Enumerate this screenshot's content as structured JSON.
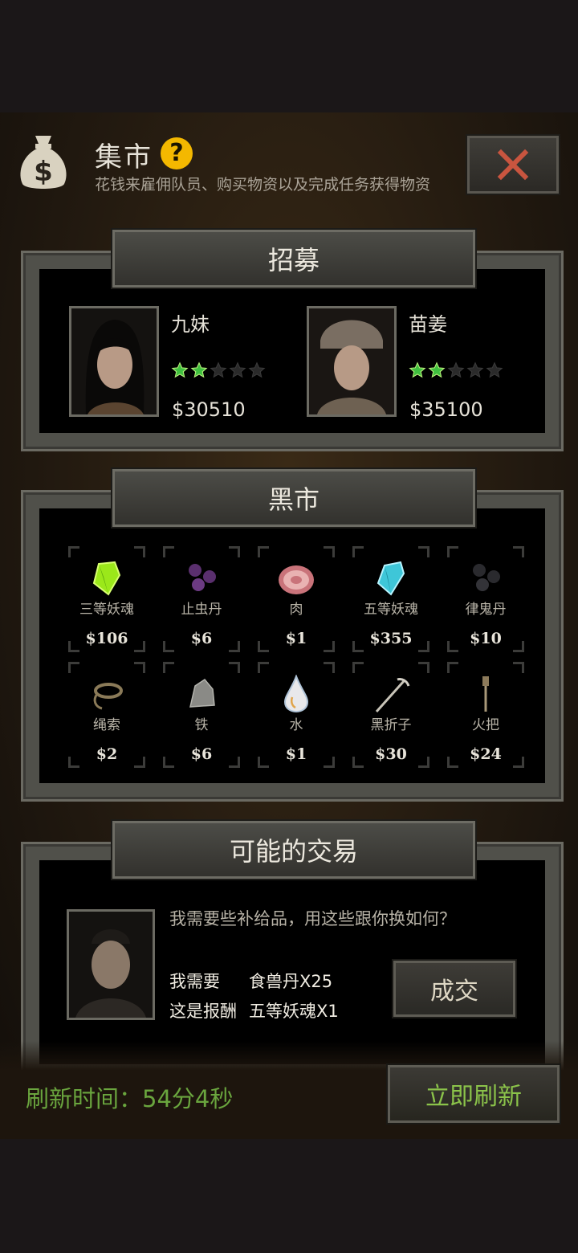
{
  "header": {
    "title": "集市",
    "subtitle": "花钱来雇佣队员、购买物资以及完成任务获得物资",
    "help_icon_glyph": "?",
    "icons": [
      "money-bag-icon",
      "help-icon",
      "close-icon"
    ]
  },
  "recruit": {
    "title": "招募",
    "members": [
      {
        "name": "九妹",
        "stars": 2,
        "max_stars": 5,
        "price": "$30510"
      },
      {
        "name": "苗姜",
        "stars": 2,
        "max_stars": 5,
        "price": "$35100"
      }
    ]
  },
  "market": {
    "title": "黑市",
    "items": [
      {
        "name": "三等妖魂",
        "price": "$106",
        "icon": "green-crystal-icon"
      },
      {
        "name": "止虫丹",
        "price": "$6",
        "icon": "purple-pills-icon"
      },
      {
        "name": "肉",
        "price": "$1",
        "icon": "meat-icon"
      },
      {
        "name": "五等妖魂",
        "price": "$355",
        "icon": "cyan-crystal-icon"
      },
      {
        "name": "律鬼丹",
        "price": "$10",
        "icon": "black-pills-icon"
      },
      {
        "name": "绳索",
        "price": "$2",
        "icon": "rope-icon"
      },
      {
        "name": "铁",
        "price": "$6",
        "icon": "iron-ore-icon"
      },
      {
        "name": "水",
        "price": "$1",
        "icon": "water-drop-icon"
      },
      {
        "name": "黑折子",
        "price": "$30",
        "icon": "pickaxe-icon"
      },
      {
        "name": "火把",
        "price": "$24",
        "icon": "torch-icon"
      }
    ]
  },
  "trade": {
    "title": "可能的交易",
    "message": "我需要些补给品，用这些跟你换如何？",
    "need_label": "我需要",
    "need_value": "食兽丹X25",
    "reward_label": "这是报酬",
    "reward_value": "五等妖魂X1",
    "deal_label": "成交"
  },
  "footer": {
    "refresh_time": "刷新时间：54分4秒",
    "refresh_label": "立即刷新"
  },
  "colors": {
    "accent_green": "#8bc34a",
    "star_green": "#3fbf3f",
    "help_yellow": "#f4b800",
    "close_red": "#c9553f"
  }
}
